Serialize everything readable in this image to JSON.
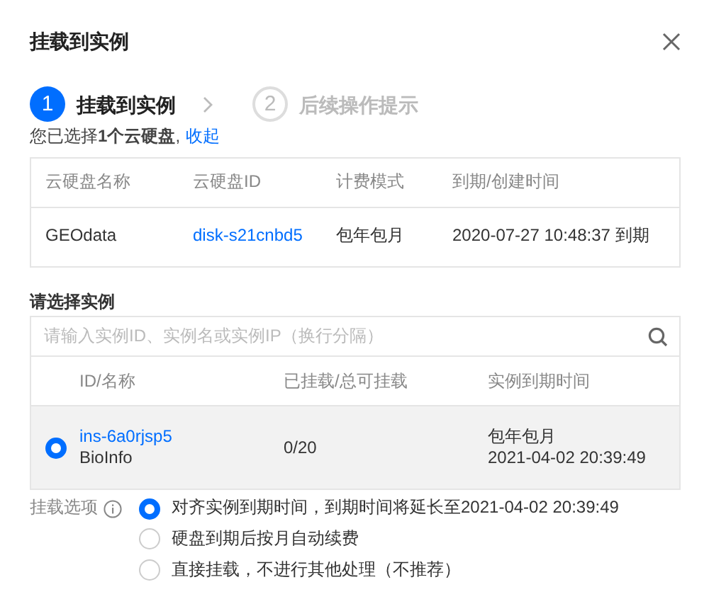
{
  "dialog": {
    "title": "挂载到实例"
  },
  "steps": [
    {
      "number": "1",
      "label": "挂载到实例",
      "selected": true
    },
    {
      "number": "2",
      "label": "后续操作提示",
      "selected": false
    }
  ],
  "selection_summary": {
    "text": "您已选择**1个云硬盘**,",
    "link": "收起"
  },
  "disk_table": {
    "columns": [
      "云硬盘名称",
      "云硬盘ID",
      "计费模式",
      "到期/创建时间"
    ],
    "rows": [
      {
        "name": "GEOdata",
        "disk_id": "disk-s21cnbd5",
        "billing": "包年包月",
        "expiry": "2020-07-27 10:48:37 到期"
      }
    ]
  },
  "instance_section": {
    "label": "请选择实例",
    "search": {
      "placeholder": "请输入实例ID、实例名或实例IP（换行分隔）"
    },
    "columns": [
      "ID/名称",
      "已挂载/总可挂载",
      "实例到期时间"
    ],
    "rows": [
      {
        "selected": true,
        "id": "ins-6a0rjsp5",
        "name": "BioInfo",
        "mounted": "0/20",
        "billing": "包年包月",
        "expiry": "2021-04-02 20:39:49"
      }
    ]
  },
  "mount_options": {
    "label": "挂载选项",
    "options": [
      {
        "label": "对齐实例到期时间，到期时间将延长至2021-04-02 20:39:49",
        "selected": true
      },
      {
        "label": "硬盘到期后按月自动续费",
        "selected": false
      },
      {
        "label": "直接挂载，不进行其他处理（不推荐）",
        "selected": false
      }
    ]
  }
}
